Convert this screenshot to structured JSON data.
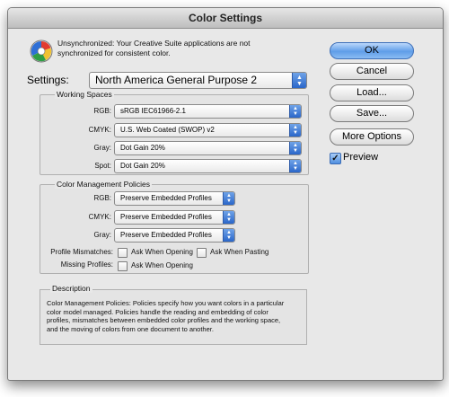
{
  "window": {
    "title": "Color Settings"
  },
  "warning": {
    "line1": "Unsynchronized: Your Creative Suite applications are not",
    "line2": "synchronized for consistent color."
  },
  "settings": {
    "label": "Settings:",
    "value": "North America General Purpose 2"
  },
  "working_spaces": {
    "title": "Working Spaces",
    "rows": [
      {
        "label": "RGB:",
        "value": "sRGB IEC61966-2.1"
      },
      {
        "label": "CMYK:",
        "value": "U.S. Web Coated (SWOP) v2"
      },
      {
        "label": "Gray:",
        "value": "Dot Gain 20%"
      },
      {
        "label": "Spot:",
        "value": "Dot Gain 20%"
      }
    ]
  },
  "policies": {
    "title": "Color Management Policies",
    "rows": [
      {
        "label": "RGB:",
        "value": "Preserve Embedded Profiles"
      },
      {
        "label": "CMYK:",
        "value": "Preserve Embedded Profiles"
      },
      {
        "label": "Gray:",
        "value": "Preserve Embedded Profiles"
      }
    ],
    "mismatches_label": "Profile Mismatches:",
    "ask_opening": "Ask When Opening",
    "ask_pasting": "Ask When Pasting",
    "missing_label": "Missing Profiles:",
    "missing_ask_opening": "Ask When Opening"
  },
  "description": {
    "title": "Description",
    "lines": [
      "Color Management Policies:  Policies specify how you want colors in a particular",
      "color model managed.  Policies handle the reading and embedding of color",
      "profiles, mismatches between embedded color profiles and the working space,",
      "and the moving of colors from one document to another."
    ]
  },
  "buttons": {
    "ok": "OK",
    "cancel": "Cancel",
    "load": "Load...",
    "save": "Save...",
    "more_options": "More Options"
  },
  "preview": {
    "label": "Preview",
    "checked": true
  }
}
